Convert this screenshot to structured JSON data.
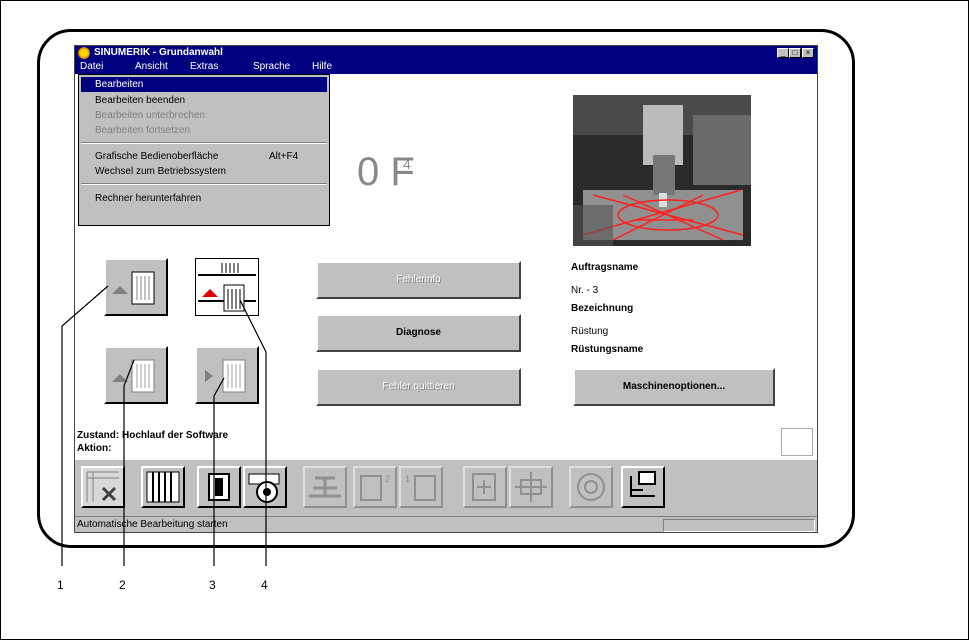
{
  "window": {
    "title": "SINUMERIK - Grundanwahl",
    "controls": [
      "_",
      "□",
      "×"
    ]
  },
  "menubar": {
    "items": [
      "Datei",
      "Ansicht",
      "Extras",
      "Sprache",
      "Hilfe"
    ]
  },
  "file_menu": {
    "items": [
      {
        "label": "Bearbeiten",
        "state": "selected"
      },
      {
        "label": "Bearbeiten beenden",
        "state": "enabled"
      },
      {
        "label": "Bearbeiten unterbrechen",
        "state": "disabled"
      },
      {
        "label": "Bearbeiten fortsetzen",
        "state": "disabled"
      },
      {
        "label": "Grafische Bedienoberfläche",
        "shortcut": "Alt+F4",
        "state": "enabled"
      },
      {
        "label": "Wechsel zum Betriebssystem",
        "state": "enabled"
      },
      {
        "label": "Rechner herunterfahren",
        "state": "enabled"
      }
    ]
  },
  "main": {
    "big_text": "0 F",
    "big_sup": "4",
    "buttons": {
      "fehlerinfo": "Fehlerinfo",
      "diagnose": "Diagnose",
      "fehler_quittieren": "Fehler quittieren",
      "maschinenoptionen": "Maschinenoptionen..."
    },
    "info": {
      "auftragsname": "Auftragsname",
      "nr": "Nr. - 3",
      "bezeichnung": "Bezeichnung",
      "kustung": "Rüstung",
      "rustungsname": "Rüstungsname"
    }
  },
  "status": {
    "line1": "Zustand: Hochlauf der Software",
    "line2": "Aktion:",
    "statusbar": "Automatische Bearbeitung starten"
  },
  "callouts": [
    "1",
    "2",
    "3",
    "4"
  ],
  "colors": {
    "titlebar": "#000080",
    "face": "#c0c0c0",
    "arrow_red": "#e00000"
  }
}
